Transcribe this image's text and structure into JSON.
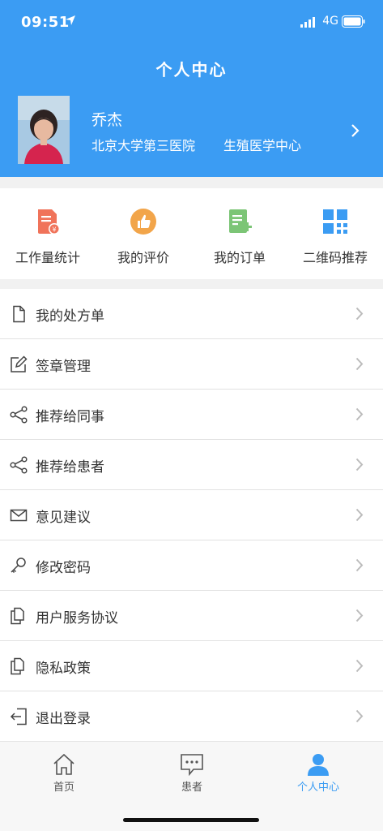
{
  "status_bar": {
    "time": "09:51",
    "network": "4G"
  },
  "header": {
    "title": "个人中心"
  },
  "profile": {
    "name": "乔杰",
    "hospital": "北京大学第三医院",
    "department": "生殖医学中心"
  },
  "quick_actions": [
    {
      "label": "工作量统计",
      "icon": "workload-stats-icon",
      "color": "#f0735a"
    },
    {
      "label": "我的评价",
      "icon": "thumbs-up-icon",
      "color": "#f2a54a"
    },
    {
      "label": "我的订单",
      "icon": "order-icon",
      "color": "#7cc576"
    },
    {
      "label": "二维码推荐",
      "icon": "qr-code-icon",
      "color": "#3b9cf3"
    }
  ],
  "menu": [
    {
      "label": "我的处方单",
      "icon": "document-icon"
    },
    {
      "label": "签章管理",
      "icon": "edit-icon"
    },
    {
      "label": "推荐给同事",
      "icon": "share-icon"
    },
    {
      "label": "推荐给患者",
      "icon": "share-icon"
    },
    {
      "label": "意见建议",
      "icon": "mail-icon"
    },
    {
      "label": "修改密码",
      "icon": "key-icon"
    },
    {
      "label": "用户服务协议",
      "icon": "documents-icon"
    },
    {
      "label": "隐私政策",
      "icon": "documents-icon"
    },
    {
      "label": "退出登录",
      "icon": "logout-icon"
    }
  ],
  "tabbar": [
    {
      "label": "首页",
      "icon": "home-icon",
      "active": false
    },
    {
      "label": "患者",
      "icon": "chat-icon",
      "active": false
    },
    {
      "label": "个人中心",
      "icon": "person-icon",
      "active": true
    }
  ],
  "colors": {
    "primary": "#3b9cf3",
    "background": "#f1f1f1"
  }
}
